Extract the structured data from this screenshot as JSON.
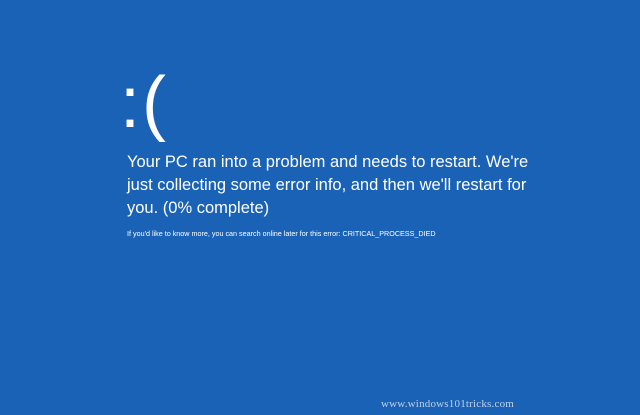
{
  "bsod": {
    "face": ":(",
    "message": "Your PC ran into a problem and needs to restart. We're just collecting some error info, and then we'll restart for you. (0% complete)",
    "details": "If you'd like to know more, you can search online later for this error: CRITICAL_PROCESS_DIED"
  },
  "watermark": {
    "text": "www.windows101tricks.com"
  },
  "colors": {
    "background": "#1a62b5",
    "text": "#ffffff"
  }
}
